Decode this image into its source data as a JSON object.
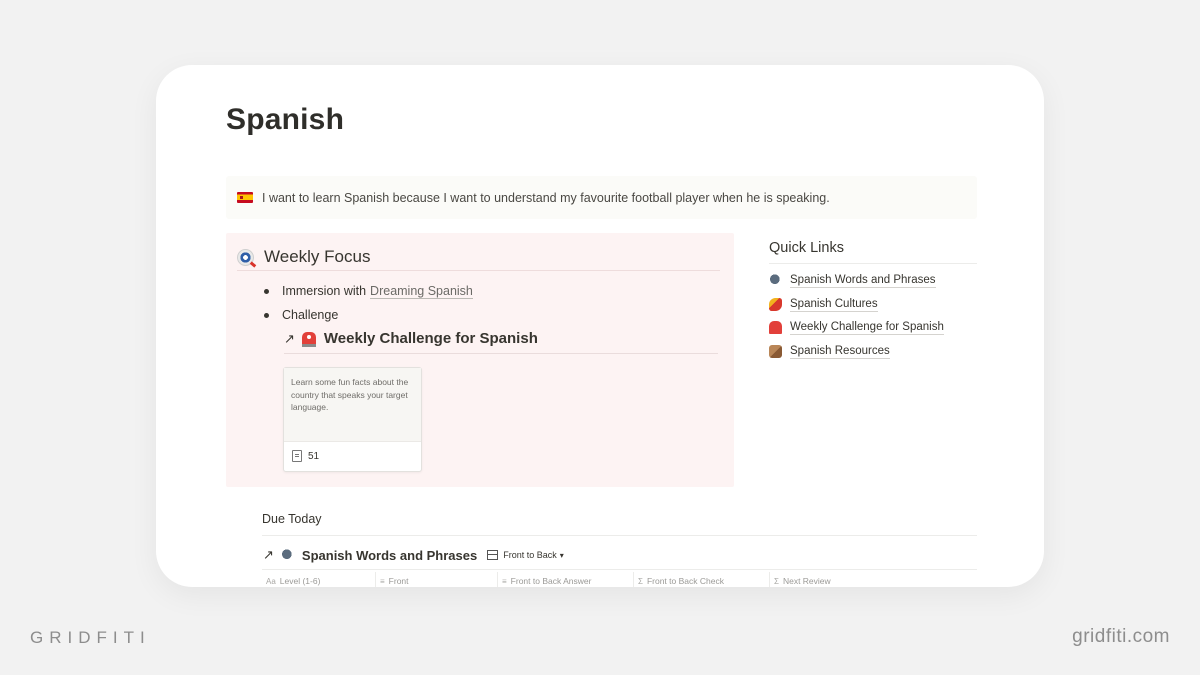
{
  "page": {
    "title": "Spanish",
    "callout": {
      "icon": "spain-flag-icon",
      "text": "I want to learn Spanish because I want to understand my favourite football player when he is speaking."
    }
  },
  "weekly_focus": {
    "title": "Weekly Focus",
    "icon": "target-icon",
    "bullets": [
      {
        "prefix": "Immersion with",
        "link": "Dreaming Spanish"
      },
      {
        "prefix": "Challenge"
      }
    ],
    "linked_page": {
      "icon": "siren-icon",
      "title": "Weekly Challenge for Spanish"
    },
    "gallery_card": {
      "text": "Learn some fun facts about the country that speaks your target language.",
      "count": "51"
    }
  },
  "quick_links": {
    "title": "Quick Links",
    "items": [
      {
        "label": "Spanish Words and Phrases",
        "icon": "speaking-head-icon"
      },
      {
        "label": "Spanish Cultures",
        "icon": "dancer-icon"
      },
      {
        "label": "Weekly Challenge for Spanish",
        "icon": "siren-icon"
      },
      {
        "label": "Spanish Resources",
        "icon": "box-icon"
      }
    ]
  },
  "due_today": {
    "title": "Due Today",
    "database": {
      "title": "Spanish Words and Phrases",
      "view": "Front to Back",
      "columns": [
        {
          "label": "Level (1-6)",
          "type_icon": "Aa"
        },
        {
          "label": "Front",
          "type_icon": "≡"
        },
        {
          "label": "Front to Back Answer",
          "type_icon": "≡"
        },
        {
          "label": "Front to Back Check",
          "type_icon": "Σ"
        },
        {
          "label": "Next Review",
          "type_icon": "Σ"
        }
      ]
    }
  },
  "branding": {
    "left": "GRIDFITI",
    "right": "gridfiti.com"
  }
}
